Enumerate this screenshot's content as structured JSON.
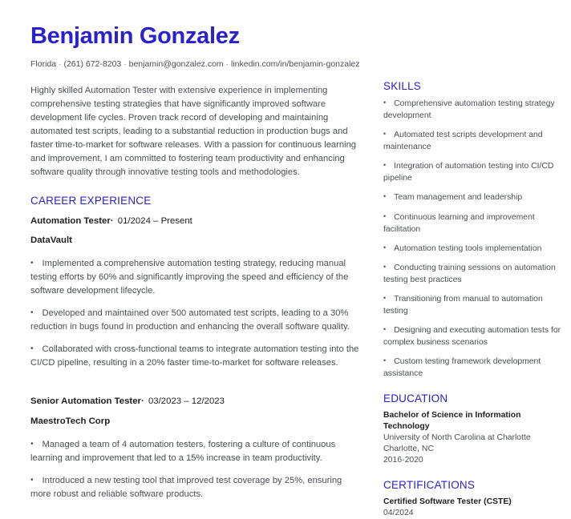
{
  "theme": {
    "accent": "#2a21cc",
    "body_text": "#4a4f54",
    "heading_text": "#1d1f22",
    "background": "#ffffff"
  },
  "header": {
    "name": "Benjamin Gonzalez",
    "separator": "·",
    "contact": {
      "location": "Florida",
      "phone": "(261) 672-8203",
      "email": "benjamin@gonzalez.com",
      "linkedin": "linkedin.com/in/benjamin-gonzalez"
    }
  },
  "summary": {
    "text": "Highly skilled Automation Tester with extensive experience in implementing comprehensive testing strategies that have significantly improved software development life cycles. Proven track record of developing and maintaining automated test scripts, leading to a substantial reduction in production bugs and faster time-to-market for software releases. With a passion for continuous learning and improvement, I am committed to fostering team productivity and enhancing software quality through innovative testing tools and methodologies."
  },
  "experience": {
    "heading": "CAREER EXPERIENCE",
    "bullet_glyph": "•",
    "title_separator": "·",
    "jobs": [
      {
        "role": "Automation Tester",
        "dates": "01/2024 – Present",
        "company": "DataVault",
        "bullets": [
          "Implemented a comprehensive automation testing strategy, reducing manual testing efforts by 60% and significantly improving the speed and efficiency of the software development lifecycle.",
          "Developed and maintained over 500 automated test scripts, leading to a 30% reduction in bugs found in production and enhancing the overall software quality.",
          "Collaborated with cross-functional teams to integrate automation testing into the CI/CD pipeline, resulting in a 20% faster time-to-market for software releases."
        ]
      },
      {
        "role": "Senior Automation Tester",
        "dates": "03/2023 – 12/2023",
        "company": "MaestroTech Corp",
        "bullets": [
          "Managed a team of 4 automation testers, fostering a culture of continuous learning and improvement that led to a 15% increase in team productivity.",
          "Introduced a new testing tool that improved test coverage by 25%, ensuring more robust and reliable software products."
        ]
      }
    ]
  },
  "skills": {
    "heading": "SKILLS",
    "bullet_glyph": "•",
    "items": [
      "Comprehensive automation testing strategy development",
      "Automated test scripts development and maintenance",
      "Integration of automation testing into CI/CD pipeline",
      "Team management and leadership",
      "Continuous learning and improvement facilitation",
      "Automation testing tools implementation",
      "Conducting training sessions on automation testing best practices",
      "Transitioning from manual to automation testing",
      "Designing and executing automation tests for complex business scenarios",
      "Custom testing framework development assistance"
    ]
  },
  "education": {
    "heading": "EDUCATION",
    "entries": [
      {
        "degree": "Bachelor of Science in Information Technology",
        "school": "University of North Carolina at Charlotte",
        "location": "Charlotte, NC",
        "dates": "2016-2020"
      }
    ]
  },
  "certifications": {
    "heading": "CERTIFICATIONS",
    "entries": [
      {
        "title": "Certified Software Tester (CSTE)",
        "date": "04/2024"
      }
    ]
  }
}
